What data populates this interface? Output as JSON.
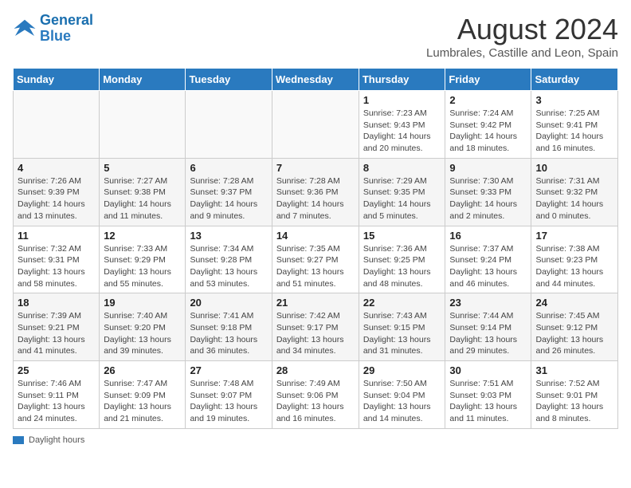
{
  "header": {
    "logo_line1": "General",
    "logo_line2": "Blue",
    "main_title": "August 2024",
    "sub_title": "Lumbrales, Castille and Leon, Spain"
  },
  "days_of_week": [
    "Sunday",
    "Monday",
    "Tuesday",
    "Wednesday",
    "Thursday",
    "Friday",
    "Saturday"
  ],
  "weeks": [
    [
      {
        "day": "",
        "info": ""
      },
      {
        "day": "",
        "info": ""
      },
      {
        "day": "",
        "info": ""
      },
      {
        "day": "",
        "info": ""
      },
      {
        "day": "1",
        "info": "Sunrise: 7:23 AM\nSunset: 9:43 PM\nDaylight: 14 hours and 20 minutes."
      },
      {
        "day": "2",
        "info": "Sunrise: 7:24 AM\nSunset: 9:42 PM\nDaylight: 14 hours and 18 minutes."
      },
      {
        "day": "3",
        "info": "Sunrise: 7:25 AM\nSunset: 9:41 PM\nDaylight: 14 hours and 16 minutes."
      }
    ],
    [
      {
        "day": "4",
        "info": "Sunrise: 7:26 AM\nSunset: 9:39 PM\nDaylight: 14 hours and 13 minutes."
      },
      {
        "day": "5",
        "info": "Sunrise: 7:27 AM\nSunset: 9:38 PM\nDaylight: 14 hours and 11 minutes."
      },
      {
        "day": "6",
        "info": "Sunrise: 7:28 AM\nSunset: 9:37 PM\nDaylight: 14 hours and 9 minutes."
      },
      {
        "day": "7",
        "info": "Sunrise: 7:28 AM\nSunset: 9:36 PM\nDaylight: 14 hours and 7 minutes."
      },
      {
        "day": "8",
        "info": "Sunrise: 7:29 AM\nSunset: 9:35 PM\nDaylight: 14 hours and 5 minutes."
      },
      {
        "day": "9",
        "info": "Sunrise: 7:30 AM\nSunset: 9:33 PM\nDaylight: 14 hours and 2 minutes."
      },
      {
        "day": "10",
        "info": "Sunrise: 7:31 AM\nSunset: 9:32 PM\nDaylight: 14 hours and 0 minutes."
      }
    ],
    [
      {
        "day": "11",
        "info": "Sunrise: 7:32 AM\nSunset: 9:31 PM\nDaylight: 13 hours and 58 minutes."
      },
      {
        "day": "12",
        "info": "Sunrise: 7:33 AM\nSunset: 9:29 PM\nDaylight: 13 hours and 55 minutes."
      },
      {
        "day": "13",
        "info": "Sunrise: 7:34 AM\nSunset: 9:28 PM\nDaylight: 13 hours and 53 minutes."
      },
      {
        "day": "14",
        "info": "Sunrise: 7:35 AM\nSunset: 9:27 PM\nDaylight: 13 hours and 51 minutes."
      },
      {
        "day": "15",
        "info": "Sunrise: 7:36 AM\nSunset: 9:25 PM\nDaylight: 13 hours and 48 minutes."
      },
      {
        "day": "16",
        "info": "Sunrise: 7:37 AM\nSunset: 9:24 PM\nDaylight: 13 hours and 46 minutes."
      },
      {
        "day": "17",
        "info": "Sunrise: 7:38 AM\nSunset: 9:23 PM\nDaylight: 13 hours and 44 minutes."
      }
    ],
    [
      {
        "day": "18",
        "info": "Sunrise: 7:39 AM\nSunset: 9:21 PM\nDaylight: 13 hours and 41 minutes."
      },
      {
        "day": "19",
        "info": "Sunrise: 7:40 AM\nSunset: 9:20 PM\nDaylight: 13 hours and 39 minutes."
      },
      {
        "day": "20",
        "info": "Sunrise: 7:41 AM\nSunset: 9:18 PM\nDaylight: 13 hours and 36 minutes."
      },
      {
        "day": "21",
        "info": "Sunrise: 7:42 AM\nSunset: 9:17 PM\nDaylight: 13 hours and 34 minutes."
      },
      {
        "day": "22",
        "info": "Sunrise: 7:43 AM\nSunset: 9:15 PM\nDaylight: 13 hours and 31 minutes."
      },
      {
        "day": "23",
        "info": "Sunrise: 7:44 AM\nSunset: 9:14 PM\nDaylight: 13 hours and 29 minutes."
      },
      {
        "day": "24",
        "info": "Sunrise: 7:45 AM\nSunset: 9:12 PM\nDaylight: 13 hours and 26 minutes."
      }
    ],
    [
      {
        "day": "25",
        "info": "Sunrise: 7:46 AM\nSunset: 9:11 PM\nDaylight: 13 hours and 24 minutes."
      },
      {
        "day": "26",
        "info": "Sunrise: 7:47 AM\nSunset: 9:09 PM\nDaylight: 13 hours and 21 minutes."
      },
      {
        "day": "27",
        "info": "Sunrise: 7:48 AM\nSunset: 9:07 PM\nDaylight: 13 hours and 19 minutes."
      },
      {
        "day": "28",
        "info": "Sunrise: 7:49 AM\nSunset: 9:06 PM\nDaylight: 13 hours and 16 minutes."
      },
      {
        "day": "29",
        "info": "Sunrise: 7:50 AM\nSunset: 9:04 PM\nDaylight: 13 hours and 14 minutes."
      },
      {
        "day": "30",
        "info": "Sunrise: 7:51 AM\nSunset: 9:03 PM\nDaylight: 13 hours and 11 minutes."
      },
      {
        "day": "31",
        "info": "Sunrise: 7:52 AM\nSunset: 9:01 PM\nDaylight: 13 hours and 8 minutes."
      }
    ]
  ],
  "footer": {
    "legend_label": "Daylight hours"
  },
  "colors": {
    "header_bg": "#2a7abf",
    "accent": "#1a6faf"
  }
}
